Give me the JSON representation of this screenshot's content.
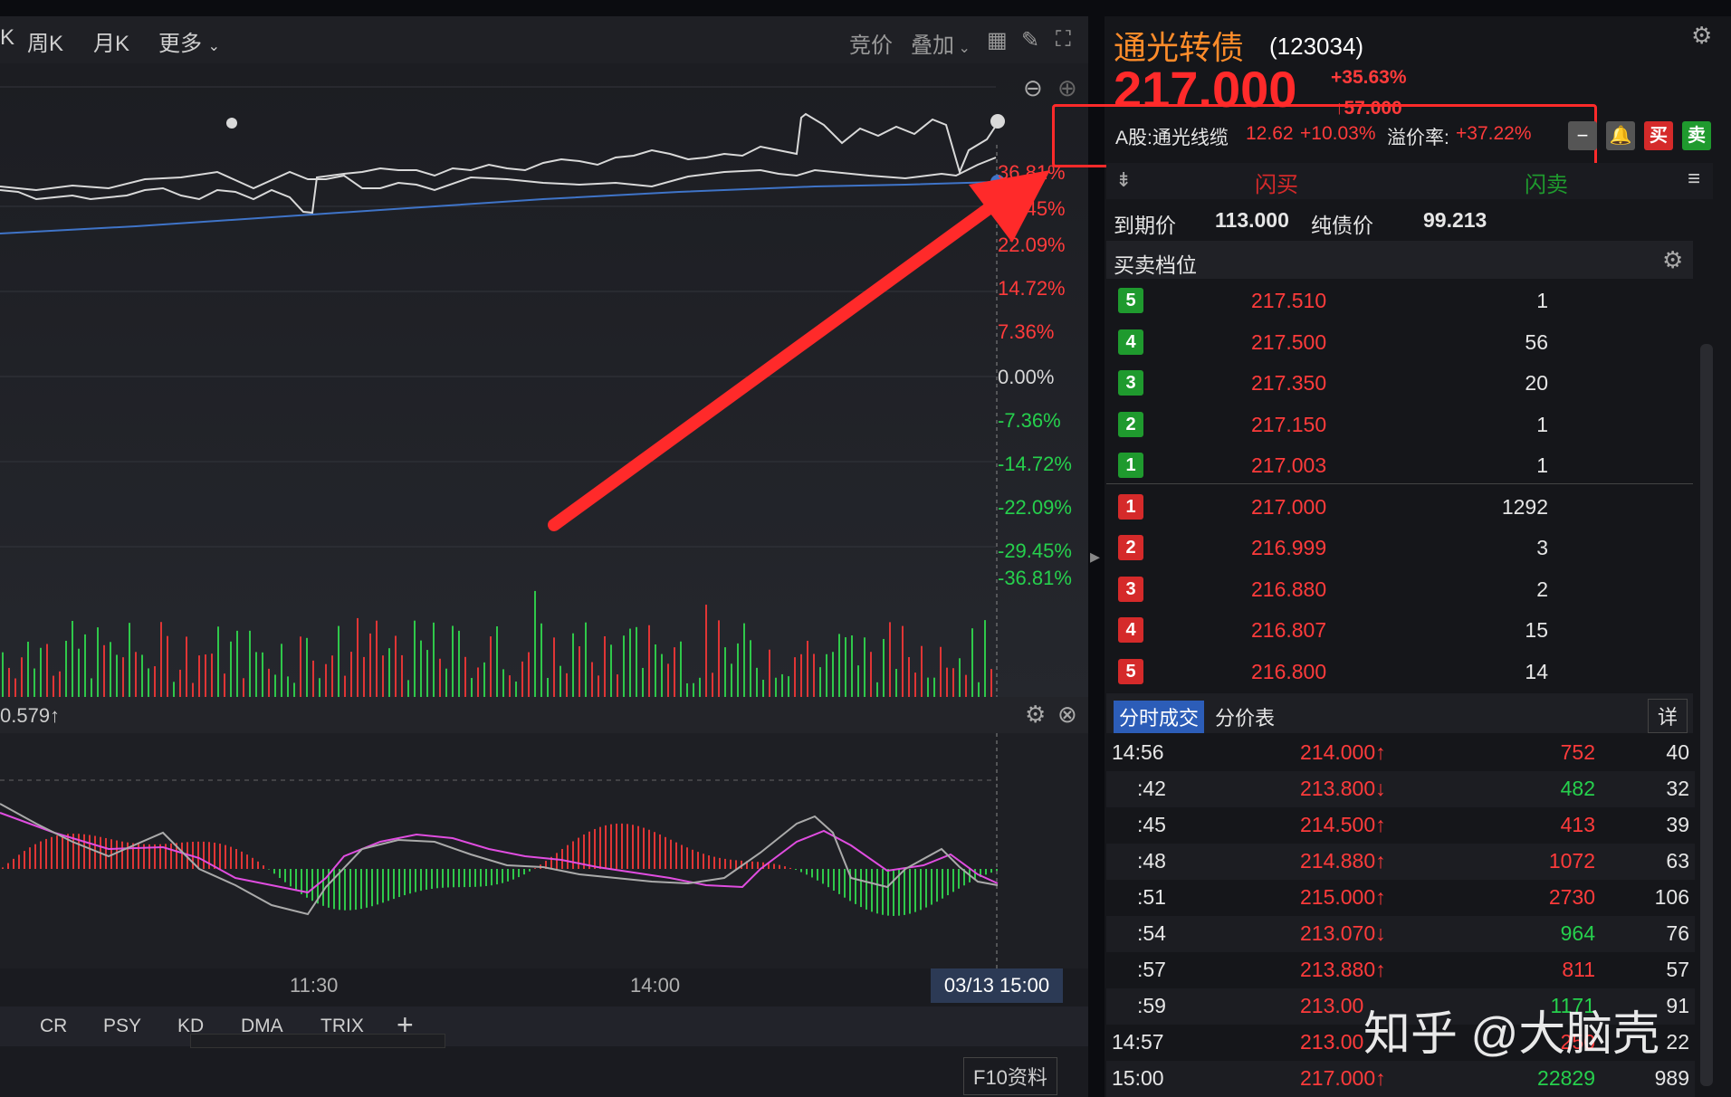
{
  "toolbar": {
    "k_left": "K",
    "week_k": "周K",
    "month_k": "月K",
    "more": "更多",
    "auction": "竞价",
    "overlay": "叠加"
  },
  "chart": {
    "pct_labels": [
      "36.81%",
      "29.45%",
      "22.09%",
      "14.72%",
      "7.36%",
      "0.00%",
      "-7.36%",
      "-14.72%",
      "-22.09%",
      "-29.45%",
      "-36.81%"
    ],
    "indicator_value": "0.579↑",
    "time_labels": [
      "11:30",
      "14:00"
    ],
    "crosshair_time": "03/13 15:00",
    "bottom_tabs": [
      "CR",
      "PSY",
      "KD",
      "DMA",
      "TRIX"
    ],
    "f10": "F10资料"
  },
  "quote": {
    "name": "通光转债",
    "code": "(123034)",
    "price": "217.000",
    "change_pct": "+35.63%",
    "change_abs": "↑57.000",
    "stock_label": "A股:通光线缆",
    "stock_price": "12.62",
    "stock_change": "+10.03%",
    "premium_label": "溢价率:",
    "premium_value": "+37.22%",
    "buy_btn": "买",
    "sell_btn": "卖",
    "flash_buy": "闪买",
    "flash_sell": "闪卖",
    "maturity_label": "到期价",
    "maturity_value": "113.000",
    "bond_value_label": "纯债价",
    "bond_value": "99.213",
    "orderbook_title": "买卖档位"
  },
  "orderbook": {
    "asks": [
      {
        "level": "5",
        "price": "217.510",
        "vol": "1"
      },
      {
        "level": "4",
        "price": "217.500",
        "vol": "56"
      },
      {
        "level": "3",
        "price": "217.350",
        "vol": "20"
      },
      {
        "level": "2",
        "price": "217.150",
        "vol": "1"
      },
      {
        "level": "1",
        "price": "217.003",
        "vol": "1"
      }
    ],
    "bids": [
      {
        "level": "1",
        "price": "217.000",
        "vol": "1292"
      },
      {
        "level": "2",
        "price": "216.999",
        "vol": "3"
      },
      {
        "level": "3",
        "price": "216.880",
        "vol": "2"
      },
      {
        "level": "4",
        "price": "216.807",
        "vol": "15"
      },
      {
        "level": "5",
        "price": "216.800",
        "vol": "14"
      }
    ]
  },
  "trades": {
    "tab_active": "分时成交",
    "tab_other": "分价表",
    "detail": "详",
    "rows": [
      {
        "time": "14:56",
        "price": "214.000↑",
        "vol": "752",
        "vc": "red",
        "cnt": "40"
      },
      {
        "time": ":42",
        "price": "213.800↓",
        "vol": "482",
        "vc": "green",
        "cnt": "32"
      },
      {
        "time": ":45",
        "price": "214.500↑",
        "vol": "413",
        "vc": "red",
        "cnt": "39"
      },
      {
        "time": ":48",
        "price": "214.880↑",
        "vol": "1072",
        "vc": "red",
        "cnt": "63"
      },
      {
        "time": ":51",
        "price": "215.000↑",
        "vol": "2730",
        "vc": "red",
        "cnt": "106"
      },
      {
        "time": ":54",
        "price": "213.070↓",
        "vol": "964",
        "vc": "green",
        "cnt": "76"
      },
      {
        "time": ":57",
        "price": "213.880↑",
        "vol": "811",
        "vc": "red",
        "cnt": "57"
      },
      {
        "time": ":59",
        "price": "213.00",
        "vol": "1171",
        "vc": "green",
        "cnt": "91"
      },
      {
        "time": "14:57",
        "price": "213.00",
        "vol": "250",
        "vc": "red",
        "cnt": "22"
      },
      {
        "time": "15:00",
        "price": "217.000↑",
        "vol": "22829",
        "vc": "green",
        "cnt": "989"
      }
    ]
  },
  "watermark": "知乎 @大脑壳"
}
